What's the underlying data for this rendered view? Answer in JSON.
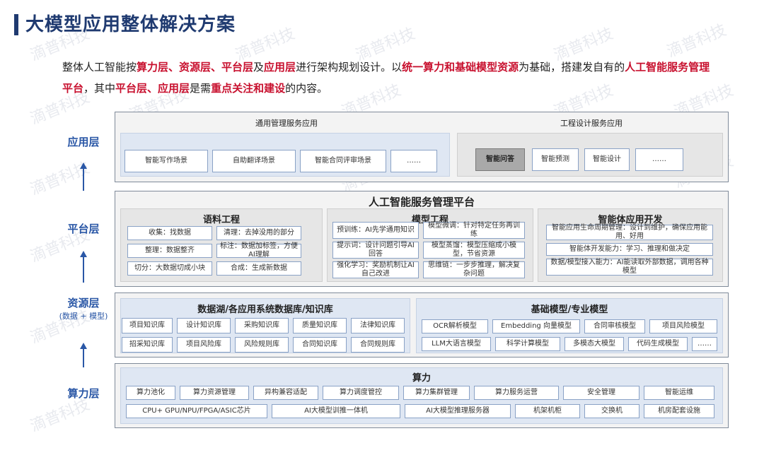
{
  "title": "大模型应用整体解决方案",
  "intro": {
    "p1": "整体人工智能按",
    "r1": "算力层、资源层、平台层",
    "p2": "及",
    "r2": "应用层",
    "p3": "进行架构规划设计。以",
    "r3": "统一算力和基础模型资源",
    "p4": "为基础，搭建发自有的",
    "r4": "人工智能服务管理平台",
    "p5": "，其中",
    "r5": "平台层、应用层",
    "p6": "是需",
    "r6": "重点关注和建设",
    "p7": "的内容。"
  },
  "layers": {
    "app": "应用层",
    "platform": "平台层",
    "resource": "资源层",
    "resource_sub": "(数据 + 模型)",
    "compute": "算力层"
  },
  "app_layer": {
    "general_title": "通用管理服务应用",
    "general_items": [
      "智能写作场景",
      "自助翻译场景",
      "智能合同评审场景",
      "……"
    ],
    "eng_title": "工程设计服务应用",
    "eng_items": [
      "智能问答",
      "智能预测",
      "智能设计",
      "……"
    ]
  },
  "platform_layer": {
    "title": "人工智能服务管理平台",
    "corpus": {
      "title": "语料工程",
      "items": [
        "收集：找数据",
        "清理：去掉没用的部分",
        "整理：数据整齐",
        "标注：数据加标签，方便AI理解",
        "切分：大数据切成小块",
        "合成：生成新数据"
      ]
    },
    "model": {
      "title": "模型工程",
      "items": [
        "预训练：AI先学通用知识",
        "模型微调：针对特定任务再训练",
        "提示词：设计问题引导AI回答",
        "模型蒸馏：模型压缩成小模型，节省资源",
        "强化学习：奖励机制让AI自己改进",
        "思维链：一步步推理，解决复杂问题"
      ]
    },
    "agent": {
      "title": "智能体应用开发",
      "items": [
        "智能应用生命周期管理：设计到维护，确保应用能用、好用",
        "智能体开发能力：学习、推理和做决定",
        "数据/模型接入能力：AI能读取外部数据，调用各种模型"
      ]
    }
  },
  "resource_layer": {
    "data_title": "数据湖/各应用系统数据库/知识库",
    "data_row1": [
      "项目知识库",
      "设计知识库",
      "采购知识库",
      "质量知识库",
      "法律知识库"
    ],
    "data_row2": [
      "招采知识库",
      "项目风险库",
      "风险规则库",
      "合同知识库",
      "合同规则库"
    ],
    "model_title": "基础模型/专业模型",
    "model_row1": [
      "OCR解析模型",
      "Embedding 向量模型",
      "合同审核模型",
      "项目风险模型"
    ],
    "model_row2": [
      "LLM大语言模型",
      "科学计算模型",
      "多模态大模型",
      "代码生成模型",
      "……"
    ]
  },
  "compute_layer": {
    "title": "算力",
    "row1": [
      "算力池化",
      "算力资源管理",
      "异构兼容适配",
      "算力调度管控",
      "算力集群管理",
      "算力服务运营",
      "安全管理",
      "智能运维"
    ],
    "row2": [
      "CPU+ GPU/NPU/FPGA/ASIC芯片",
      "AI大模型训推一体机",
      "AI大模型推理服务器",
      "机架机柜",
      "交换机",
      "机房配套设施"
    ]
  },
  "watermark": "滴普科技"
}
